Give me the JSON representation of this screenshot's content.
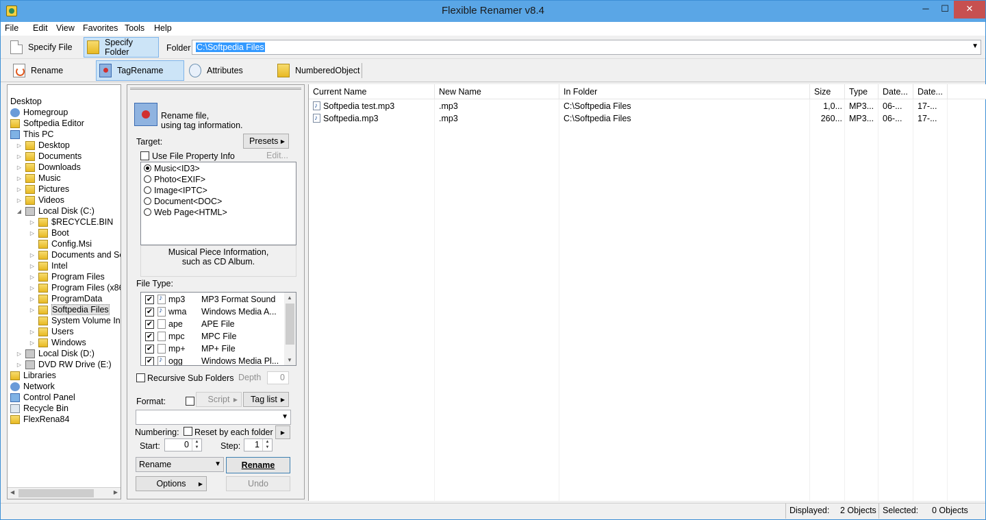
{
  "window": {
    "title": "Flexible Renamer v8.4",
    "minimize": "─",
    "maximize": "☐",
    "close": "✕"
  },
  "menu": [
    "File",
    "Edit",
    "View",
    "Favorites",
    "Tools",
    "Help"
  ],
  "toolbar1": {
    "specify_file": "Specify File",
    "specify_folder": "Specify Folder",
    "folder_label": "Folder",
    "folder_value": "C:\\Softpedia Files"
  },
  "toolbar2": {
    "rename": "Rename",
    "tagrename": "TagRename",
    "attributes": "Attributes",
    "numbered_object": "NumberedObject"
  },
  "tree": [
    {
      "label": "Desktop",
      "icon": "desktop-icon",
      "level": 0,
      "expander": ""
    },
    {
      "label": "Homegroup",
      "icon": "homegroup-icon",
      "level": 0,
      "expander": ""
    },
    {
      "label": "Softpedia Editor",
      "icon": "user-folder-icon",
      "level": 0,
      "expander": ""
    },
    {
      "label": "This PC",
      "icon": "computer-icon",
      "level": 0,
      "expander": ""
    },
    {
      "label": "Desktop",
      "icon": "folder-icon",
      "level": 1,
      "expander": "▷"
    },
    {
      "label": "Documents",
      "icon": "folder-icon",
      "level": 1,
      "expander": "▷"
    },
    {
      "label": "Downloads",
      "icon": "folder-icon",
      "level": 1,
      "expander": "▷"
    },
    {
      "label": "Music",
      "icon": "folder-icon",
      "level": 1,
      "expander": "▷"
    },
    {
      "label": "Pictures",
      "icon": "folder-icon",
      "level": 1,
      "expander": "▷"
    },
    {
      "label": "Videos",
      "icon": "folder-icon",
      "level": 1,
      "expander": "▷"
    },
    {
      "label": "Local Disk (C:)",
      "icon": "drive-icon",
      "level": 1,
      "expander": "◢"
    },
    {
      "label": "$RECYCLE.BIN",
      "icon": "folder-icon",
      "level": 2,
      "expander": "▷"
    },
    {
      "label": "Boot",
      "icon": "folder-icon",
      "level": 2,
      "expander": "▷"
    },
    {
      "label": "Config.Msi",
      "icon": "folder-icon",
      "level": 2,
      "expander": ""
    },
    {
      "label": "Documents and Se",
      "icon": "folder-icon",
      "level": 2,
      "expander": "▷"
    },
    {
      "label": "Intel",
      "icon": "folder-icon",
      "level": 2,
      "expander": "▷"
    },
    {
      "label": "Program Files",
      "icon": "folder-icon",
      "level": 2,
      "expander": "▷"
    },
    {
      "label": "Program Files (x86",
      "icon": "folder-icon",
      "level": 2,
      "expander": "▷"
    },
    {
      "label": "ProgramData",
      "icon": "folder-icon",
      "level": 2,
      "expander": "▷"
    },
    {
      "label": "Softpedia Files",
      "icon": "folder-icon",
      "level": 2,
      "expander": "▷",
      "selected": true
    },
    {
      "label": "System Volume In",
      "icon": "folder-icon",
      "level": 2,
      "expander": ""
    },
    {
      "label": "Users",
      "icon": "folder-icon",
      "level": 2,
      "expander": "▷"
    },
    {
      "label": "Windows",
      "icon": "folder-icon",
      "level": 2,
      "expander": "▷"
    },
    {
      "label": "Local Disk (D:)",
      "icon": "drive-icon",
      "level": 1,
      "expander": "▷"
    },
    {
      "label": "DVD RW Drive (E:)",
      "icon": "dvd-drive-icon",
      "level": 1,
      "expander": "▷"
    },
    {
      "label": "Libraries",
      "icon": "libraries-icon",
      "level": 0,
      "expander": ""
    },
    {
      "label": "Network",
      "icon": "network-icon",
      "level": 0,
      "expander": ""
    },
    {
      "label": "Control Panel",
      "icon": "control-panel-icon",
      "level": 0,
      "expander": ""
    },
    {
      "label": "Recycle Bin",
      "icon": "recycle-bin-icon",
      "level": 0,
      "expander": ""
    },
    {
      "label": "FlexRena84",
      "icon": "folder-icon",
      "level": 0,
      "expander": ""
    }
  ],
  "tagrename": {
    "heading_line1": "Rename file,",
    "heading_line2": "using tag information.",
    "target_label": "Target:",
    "presets": "Presets",
    "use_file_property": "Use File Property Info",
    "edit": "Edit...",
    "targets": [
      {
        "label": "Music<ID3>",
        "selected": true
      },
      {
        "label": "Photo<EXIF>",
        "selected": false
      },
      {
        "label": "Image<IPTC>",
        "selected": false
      },
      {
        "label": "Document<DOC>",
        "selected": false
      },
      {
        "label": "Web Page<HTML>",
        "selected": false
      }
    ],
    "target_desc_line1": "Musical Piece Information,",
    "target_desc_line2": "such as CD Album.",
    "filetype_label": "File Type:",
    "filetypes": [
      {
        "ext": "mp3",
        "desc": "MP3 Format Sound",
        "checked": true,
        "music": true
      },
      {
        "ext": "wma",
        "desc": "Windows Media A...",
        "checked": true,
        "music": true
      },
      {
        "ext": "ape",
        "desc": "APE File",
        "checked": true,
        "music": false
      },
      {
        "ext": "mpc",
        "desc": "MPC File",
        "checked": true,
        "music": false
      },
      {
        "ext": "mp+",
        "desc": "MP+ File",
        "checked": true,
        "music": false
      },
      {
        "ext": "ogg",
        "desc": "Windows Media Pl...",
        "checked": true,
        "music": true
      }
    ],
    "recursive": "Recursive Sub Folders",
    "depth_label": "Depth",
    "depth_value": "0",
    "format_label": "Format:",
    "script": "Script",
    "tag_list": "Tag list",
    "numbering_label": "Numbering:",
    "reset_each_folder": "Reset by each folder",
    "start_label": "Start:",
    "start_value": "0",
    "step_label": "Step:",
    "step_value": "1",
    "mode_value": "Rename",
    "rename_button": "Rename",
    "options": "Options",
    "undo": "Undo"
  },
  "list": {
    "columns": [
      "Current Name",
      "New Name",
      "In Folder",
      "Size",
      "Type",
      "Date...",
      "Date..."
    ],
    "rows": [
      [
        "Softpedia test.mp3",
        ".mp3",
        "C:\\Softpedia Files",
        "1,0...",
        "MP3...",
        "06-...",
        "17-..."
      ],
      [
        "Softpedia.mp3",
        ".mp3",
        "C:\\Softpedia Files",
        "260...",
        "MP3...",
        "06-...",
        "17-..."
      ]
    ]
  },
  "status": {
    "displayed_label": "Displayed:",
    "displayed_value": "2 Objects",
    "selected_label": "Selected:",
    "selected_value": "0 Objects"
  }
}
